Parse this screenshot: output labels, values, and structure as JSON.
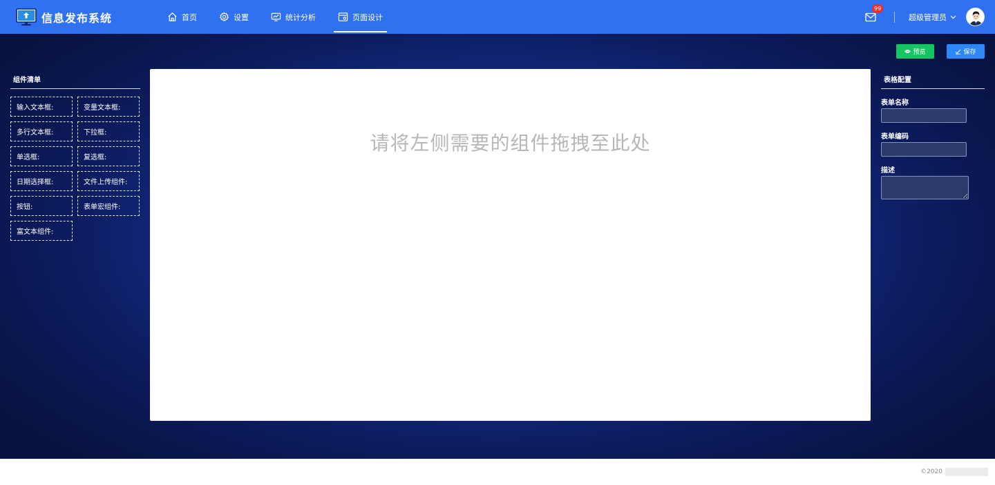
{
  "app": {
    "title": "信息发布系统",
    "brand_color": "#3071f2"
  },
  "nav": {
    "items": [
      {
        "label": "首页",
        "icon": "home-icon"
      },
      {
        "label": "设置",
        "icon": "gear-icon"
      },
      {
        "label": "统计分析",
        "icon": "chart-monitor-icon"
      },
      {
        "label": "页面设计",
        "icon": "page-design-icon",
        "active": true
      }
    ]
  },
  "header": {
    "mail_badge": "99",
    "user_name": "超级管理员"
  },
  "toolbar": {
    "preview_label": "预览",
    "save_label": "保存",
    "preview_color": "#16c464",
    "save_color": "#2f86f6"
  },
  "components_panel": {
    "title": "组件清单",
    "items": [
      "输入文本框:",
      "变量文本框:",
      "多行文本框:",
      "下拉框:",
      "单选框:",
      "复选框:",
      "日期选择框:",
      "文件上传组件:",
      "按钮:",
      "表单宏组件:",
      "富文本组件:"
    ]
  },
  "canvas": {
    "hint": "请将左侧需要的组件拖拽至此处"
  },
  "config_panel": {
    "title": "表格配置",
    "form_name_label": "表单名称",
    "form_name_value": "",
    "form_code_label": "表单编码",
    "form_code_value": "",
    "description_label": "描述",
    "description_value": ""
  },
  "footer": {
    "copyright": "©2020"
  }
}
